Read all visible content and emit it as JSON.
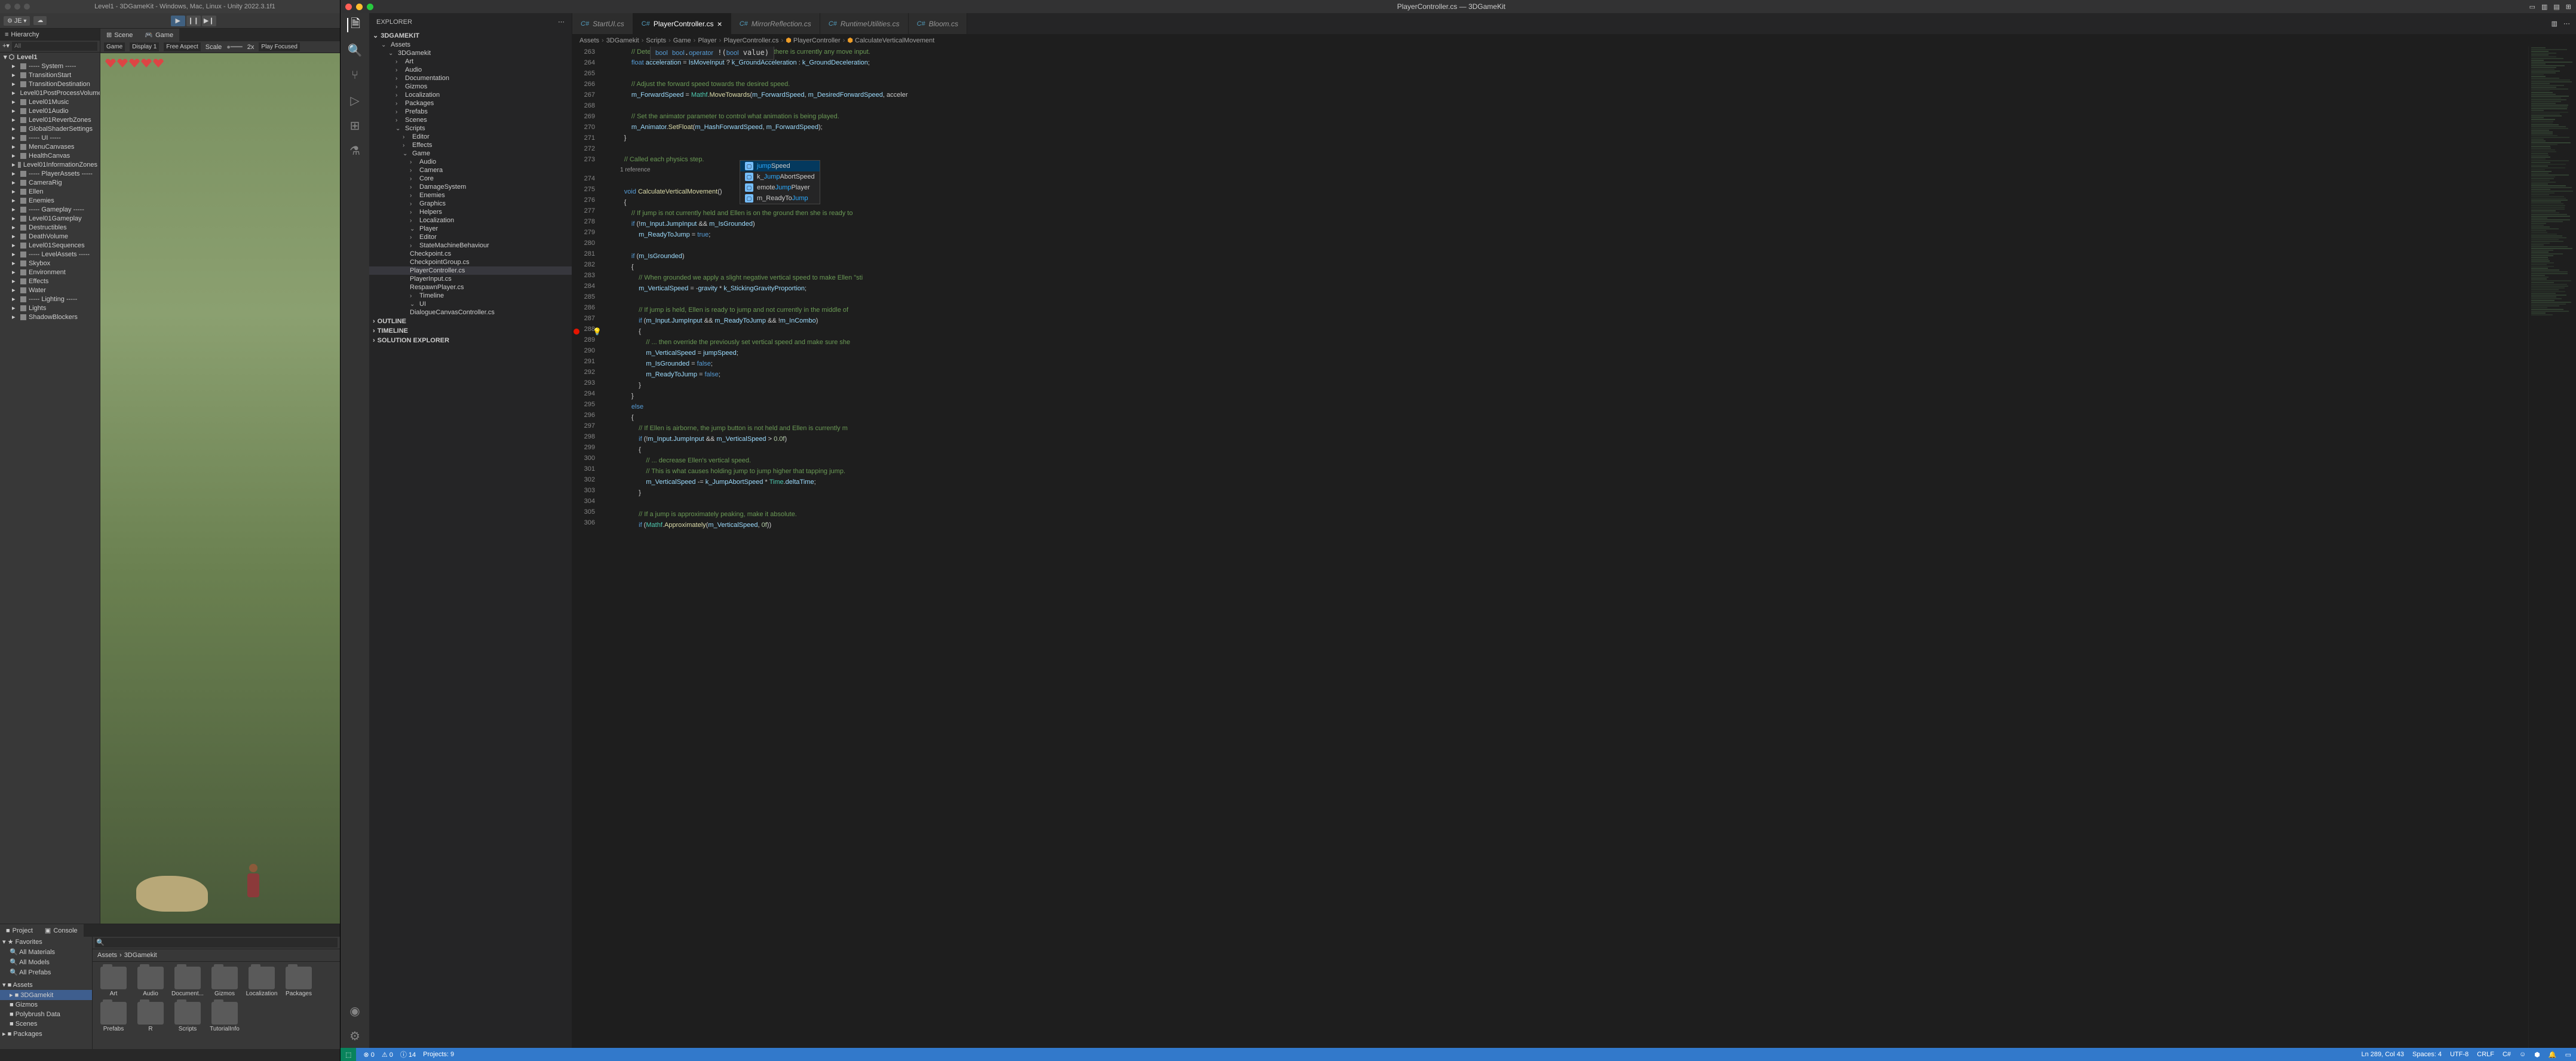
{
  "unity": {
    "title": "Level1 - 3DGameKit - Windows, Mac, Linux - Unity 2022.3.1f1",
    "account": "JE",
    "hierarchy_tab": "Hierarchy",
    "search_placeholder": "All",
    "root": "Level1",
    "items": [
      "----- System -----",
      "TransitionStart",
      "TransitionDestination",
      "Level01PostProcessVolume",
      "Level01Music",
      "Level01Audio",
      "Level01ReverbZones",
      "GlobalShaderSettings",
      "----- UI -----",
      "MenuCanvases",
      "HealthCanvas",
      "Level01InformationZones",
      "----- PlayerAssets -----",
      "CameraRig",
      "Ellen",
      "Enemies",
      "----- Gameplay -----",
      "Level01Gameplay",
      "Destructibles",
      "DeathVolume",
      "Level01Sequences",
      "----- LevelAssets -----",
      "Skybox",
      "Environment",
      "Effects",
      "Water",
      "----- Lighting -----",
      "Lights",
      "ShadowBlockers"
    ],
    "game": {
      "tab_scene": "Scene",
      "tab_game": "Game",
      "dropdown_game": "Game",
      "display": "Display 1",
      "aspect": "Free Aspect",
      "scale_label": "Scale",
      "scale_value": "2x",
      "play_focused": "Play Focused"
    },
    "project": {
      "tab_project": "Project",
      "tab_console": "Console",
      "favorites": "Favorites",
      "fav_items": [
        "All Materials",
        "All Models",
        "All Prefabs"
      ],
      "assets": "Assets",
      "asset_items": [
        "3DGamekit",
        "Gizmos",
        "Polybrush Data",
        "Scenes"
      ],
      "packages": "Packages",
      "breadcrumb": [
        "Assets",
        "3DGamekit"
      ],
      "folders": [
        "Art",
        "Audio",
        "Document...",
        "Gizmos",
        "Localization",
        "Packages",
        "Prefabs",
        "R",
        "Scripts",
        "TutorialInfo"
      ]
    }
  },
  "vscode": {
    "title": "PlayerController.cs — 3DGameKit",
    "explorer": "EXPLORER",
    "project_name": "3DGAMEKIT",
    "outline": "OUTLINE",
    "timeline": "TIMELINE",
    "solution_explorer": "SOLUTION EXPLORER",
    "tree": {
      "assets": "Assets",
      "root": "3DGamekit",
      "art": "Art",
      "audio": "Audio",
      "documentation": "Documentation",
      "gizmos": "Gizmos",
      "localization": "Localization",
      "packages": "Packages",
      "prefabs": "Prefabs",
      "scenes": "Scenes",
      "scripts": "Scripts",
      "editor": "Editor",
      "effects": "Effects",
      "game": "Game",
      "g_audio": "Audio",
      "g_camera": "Camera",
      "g_core": "Core",
      "g_damage": "DamageSystem",
      "g_enemies": "Enemies",
      "g_graphics": "Graphics",
      "g_helpers": "Helpers",
      "g_localization": "Localization",
      "g_player": "Player",
      "g_p_editor": "Editor",
      "g_p_smb": "StateMachineBehaviour",
      "g_p_checkpoint": "Checkpoint.cs",
      "g_p_checkpointgroup": "CheckpointGroup.cs",
      "g_p_playercontroller": "PlayerController.cs",
      "g_p_playerinput": "PlayerInput.cs",
      "g_p_respawn": "RespawnPlayer.cs",
      "g_timeline": "Timeline",
      "g_ui": "UI",
      "g_dialogue": "DialogueCanvasController.cs"
    },
    "tabs": [
      {
        "label": "StartUI.cs",
        "active": false
      },
      {
        "label": "PlayerController.cs",
        "active": true
      },
      {
        "label": "MirrorReflection.cs",
        "active": false
      },
      {
        "label": "RuntimeUtilities.cs",
        "active": false
      },
      {
        "label": "Bloom.cs",
        "active": false
      }
    ],
    "breadcrumb": [
      "Assets",
      "3DGamekit",
      "Scripts",
      "Game",
      "Player",
      "PlayerController.cs",
      "PlayerController",
      "CalculateVerticalMovement"
    ],
    "line_start": 263,
    "line_end": 305,
    "codelens": "1 reference",
    "hover": "bool bool.operator !(bool value)",
    "autocomplete": [
      {
        "text": "jumpSpeed",
        "match": "jump"
      },
      {
        "text": "k_JumpAbortSpeed",
        "match": "Jump"
      },
      {
        "text": "emoteJumpPlayer",
        "match": "Jump"
      },
      {
        "text": "m_ReadyToJump",
        "match": "Jump"
      }
    ],
    "code_lines": [
      "                // Determine change to speed based on whether there is currently any move input.",
      "                float acceleration = IsMoveInput ? k_GroundAcceleration : k_GroundDeceleration;",
      "",
      "                // Adjust the forward speed towards the desired speed.",
      "                m_ForwardSpeed = Mathf.MoveTowards(m_ForwardSpeed, m_DesiredForwardSpeed, acceler",
      "",
      "                // Set the animator parameter to control what animation is being played.",
      "                m_Animator.SetFloat(m_HashForwardSpeed, m_ForwardSpeed);",
      "            }",
      "",
      "            // Called each physics step.",
      "",
      "            void CalculateVerticalMovement()",
      "            {",
      "                // If jump is not currently held and Ellen is on the ground then she is ready to",
      "                if (!m_Input.JumpInput && m_IsGrounded)",
      "                    m_ReadyToJump = true;",
      "",
      "                if (m_IsGrounded)",
      "                {",
      "                    // When grounded we apply a slight negative vertical speed to make Ellen \"sti",
      "                    m_VerticalSpeed = -gravity * k_StickingGravityProportion;",
      "",
      "                    // If jump is held, Ellen is ready to jump and not currently in the middle of",
      "                    if (m_Input.JumpInput && m_ReadyToJump && !m_InCombo)",
      "                    {",
      "                        // ... then override the previously set vertical speed and make sure she",
      "                        m_VerticalSpeed = jumpSpeed;",
      "                        m_IsGrounded = false;",
      "                        m_ReadyToJump = false;",
      "                    }",
      "                }",
      "                else",
      "                {",
      "                    // If Ellen is airborne, the jump button is not held and Ellen is currently m",
      "                    if (!m_Input.JumpInput && m_VerticalSpeed > 0.0f)",
      "                    {",
      "                        // ... decrease Ellen's vertical speed.",
      "                        // This is what causes holding jump to jump higher that tapping jump.",
      "                        m_VerticalSpeed -= k_JumpAbortSpeed * Time.deltaTime;",
      "                    }",
      "",
      "                    // If a jump is approximately peaking, make it absolute.",
      "                    if (Mathf.Approximately(m_VerticalSpeed, 0f))"
    ],
    "status": {
      "errors": "0",
      "warnings": "0",
      "info": "14",
      "projects": "Projects: 9",
      "position": "Ln 289, Col 43",
      "spaces": "Spaces: 4",
      "encoding": "UTF-8",
      "eol": "CRLF",
      "lang": "C#"
    }
  }
}
